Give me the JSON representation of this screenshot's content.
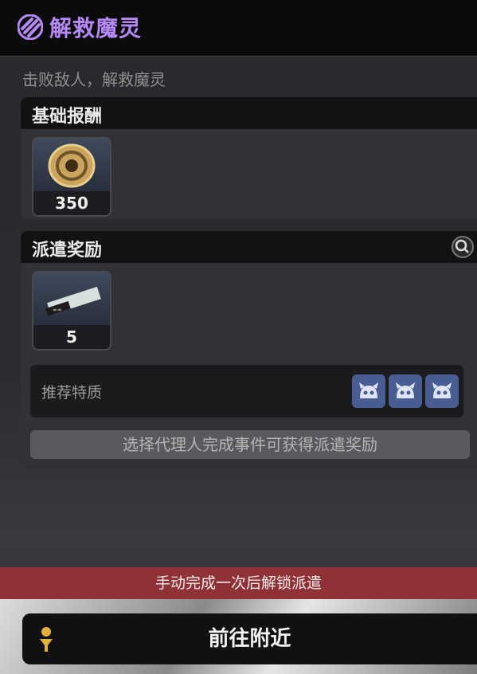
{
  "header": {
    "title": "解救魔灵",
    "title_icon": "claw-mark-icon"
  },
  "subtitle": "击败敌人，解救魔灵",
  "base_reward": {
    "label": "基础报酬",
    "items": [
      {
        "icon": "coin-icon",
        "count": "350"
      }
    ]
  },
  "dispatch_reward": {
    "label": "派遣奖励",
    "search_icon": "search-icon",
    "items": [
      {
        "icon": "tape-ticket-icon",
        "count": "5"
      }
    ],
    "traits_label": "推荐特质",
    "trait_icons": [
      "bangboo-head-icon",
      "bangboo-head-icon",
      "bangboo-head-icon"
    ],
    "info": "选择代理人完成事件可获得派遣奖励"
  },
  "lock_banner": "手动完成一次后解锁派遣",
  "go_button": {
    "label": "前往附近",
    "icon": "location-pin-icon"
  },
  "colors": {
    "accent": "#b489f5",
    "banner": "#8e3237",
    "trait": "#4a5d93"
  }
}
